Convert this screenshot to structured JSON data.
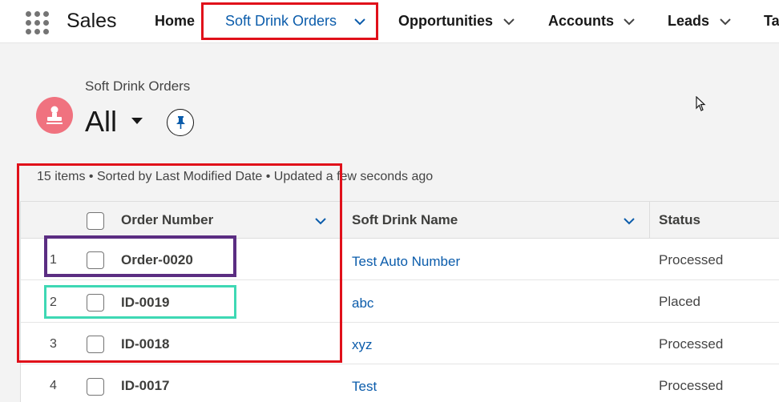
{
  "app": {
    "name": "Sales"
  },
  "nav": {
    "home": "Home",
    "soft_drink_orders": "Soft Drink Orders",
    "opportunities": "Opportunities",
    "accounts": "Accounts",
    "leads": "Leads",
    "tasks": "Ta"
  },
  "header": {
    "object_label": "Soft Drink Orders",
    "list_view": "All"
  },
  "list": {
    "meta": "15 items • Sorted by Last Modified Date • Updated a few seconds ago",
    "columns": {
      "order_number": "Order Number",
      "soft_drink_name": "Soft Drink Name",
      "status": "Status"
    },
    "rows": [
      {
        "num": "1",
        "order": "Order-0020",
        "drink": "Test Auto Number",
        "status": "Processed"
      },
      {
        "num": "2",
        "order": "ID-0019",
        "drink": "abc",
        "status": "Placed"
      },
      {
        "num": "3",
        "order": "ID-0018",
        "drink": "xyz",
        "status": "Processed"
      },
      {
        "num": "4",
        "order": "ID-0017",
        "drink": "Test",
        "status": "Processed"
      }
    ]
  },
  "colors": {
    "link": "#0b5cab",
    "object_icon": "#f0727f",
    "annotation_red": "#e0101a",
    "annotation_purple": "#5b2d82",
    "annotation_teal": "#3ed8b4"
  },
  "icons": {
    "app_launcher": "waffle-icon",
    "object": "stamp-icon",
    "pin": "pin-icon",
    "chevron": "chevron-down-icon"
  }
}
